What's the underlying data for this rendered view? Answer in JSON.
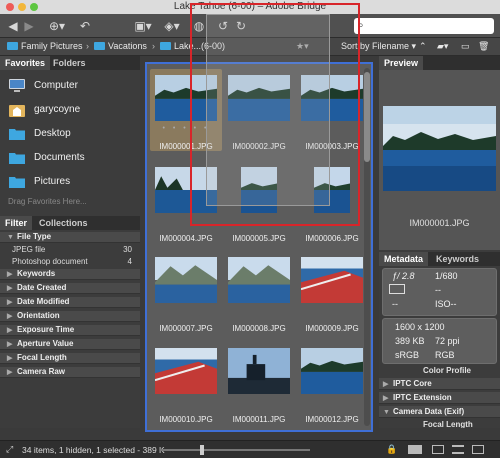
{
  "window": {
    "title": "Lake Tahoe (6-00) – Adobe Bridge"
  },
  "search": {
    "placeholder": ""
  },
  "path": {
    "crumbs": [
      "Family Pictures",
      "Vacations",
      "Lake...(6-00)"
    ],
    "sort_label": "Sort by Filename"
  },
  "left_panel": {
    "tabs": [
      "Favorites",
      "Folders"
    ],
    "favorites": [
      {
        "label": "Computer",
        "icon": "computer-icon"
      },
      {
        "label": "garycoyne",
        "icon": "home-icon"
      },
      {
        "label": "Desktop",
        "icon": "folder-icon"
      },
      {
        "label": "Documents",
        "icon": "folder-icon"
      },
      {
        "label": "Pictures",
        "icon": "folder-icon"
      }
    ],
    "drag_hint": "Drag Favorites Here...",
    "filter_tabs": [
      "Filter",
      "Collections"
    ],
    "filters": {
      "file_type": {
        "label": "File Type",
        "items": [
          {
            "label": "JPEG file",
            "count": "30"
          },
          {
            "label": "Photoshop document",
            "count": "4"
          }
        ]
      },
      "collapsed": [
        "Keywords",
        "Date Created",
        "Date Modified",
        "Orientation",
        "Exposure Time",
        "Aperture Value",
        "Focal Length",
        "Camera Raw"
      ]
    }
  },
  "content": {
    "thumbnails": [
      {
        "name": "IM000001.JPG",
        "selected": true,
        "scene": "lake-shore"
      },
      {
        "name": "IM000002.JPG",
        "selected": false,
        "scene": "lake-shore"
      },
      {
        "name": "IM000003.JPG",
        "selected": false,
        "scene": "lake-shore"
      },
      {
        "name": "IM000004.JPG",
        "selected": false,
        "scene": "lake-trees"
      },
      {
        "name": "IM000005.JPG",
        "selected": false,
        "scene": "lake-square"
      },
      {
        "name": "IM000006.JPG",
        "selected": false,
        "scene": "lake-square"
      },
      {
        "name": "IM000007.JPG",
        "selected": false,
        "scene": "mountains"
      },
      {
        "name": "IM000008.JPG",
        "selected": false,
        "scene": "mountains"
      },
      {
        "name": "IM000009.JPG",
        "selected": false,
        "scene": "boat-deck"
      },
      {
        "name": "IM000010.JPG",
        "selected": false,
        "scene": "boat-deck"
      },
      {
        "name": "IM000011.JPG",
        "selected": false,
        "scene": "boat-silhouette"
      },
      {
        "name": "IM000012.JPG",
        "selected": false,
        "scene": "lake-shore"
      }
    ]
  },
  "right_panel": {
    "preview_tab": "Preview",
    "preview_filename": "IM000001.JPG",
    "meta_tabs": [
      "Metadata",
      "Keywords"
    ],
    "metadata": {
      "aperture": "ƒ/ 2.8",
      "shutter": "1/680",
      "dash1": "--",
      "iso": "ISO--",
      "dash2": "--",
      "dash3": "--",
      "dimensions": "1600 x 1200",
      "file_size": "389 KB",
      "resolution": "72 ppi",
      "color_space": "sRGB",
      "color_mode": "RGB",
      "color_profile_label": "Color Profile"
    },
    "sections": [
      "IPTC Core",
      "IPTC Extension",
      "Camera Data (Exif)"
    ],
    "focal_length_label": "Focal Length"
  },
  "status": {
    "text": "34 items, 1 hidden, 1 selected - 389 K"
  },
  "colors": {
    "accent": "#3f6fd6",
    "folder": "#3ea7e0",
    "overlay_red": "#d8252a"
  }
}
